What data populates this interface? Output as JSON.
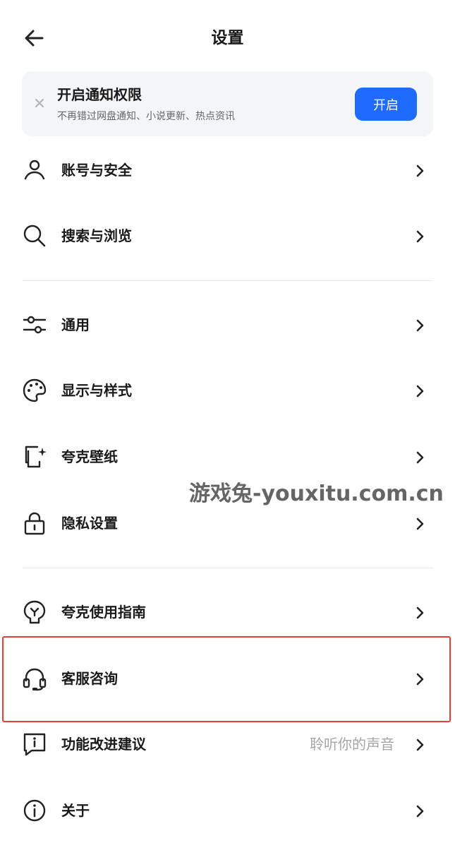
{
  "header": {
    "title": "设置",
    "back_icon": "back-arrow-icon"
  },
  "banner": {
    "title": "开启通知权限",
    "subtitle": "不再错过网盘通知、小说更新、热点资讯",
    "button_label": "开启",
    "close_icon": "close-icon",
    "button_color": "#1f6bff"
  },
  "settings": {
    "items": [
      {
        "label": "账号与安全",
        "icon": "user-icon"
      },
      {
        "label": "搜索与浏览",
        "icon": "search-icon"
      },
      {
        "label": "通用",
        "icon": "sliders-icon"
      },
      {
        "label": "显示与样式",
        "icon": "palette-icon"
      },
      {
        "label": "夸克壁纸",
        "icon": "wallpaper-icon"
      },
      {
        "label": "隐私设置",
        "icon": "lock-icon"
      },
      {
        "label": "夸克使用指南",
        "icon": "guide-bulb-icon"
      },
      {
        "label": "客服咨询",
        "icon": "headset-icon"
      },
      {
        "label": "功能改进建议",
        "icon": "feedback-icon",
        "extra": "聆听你的声音"
      },
      {
        "label": "关于",
        "icon": "info-icon"
      }
    ]
  },
  "highlight_color": "#e4403b",
  "watermark": {
    "text": "游戏兔-youxitu.com.cn"
  }
}
